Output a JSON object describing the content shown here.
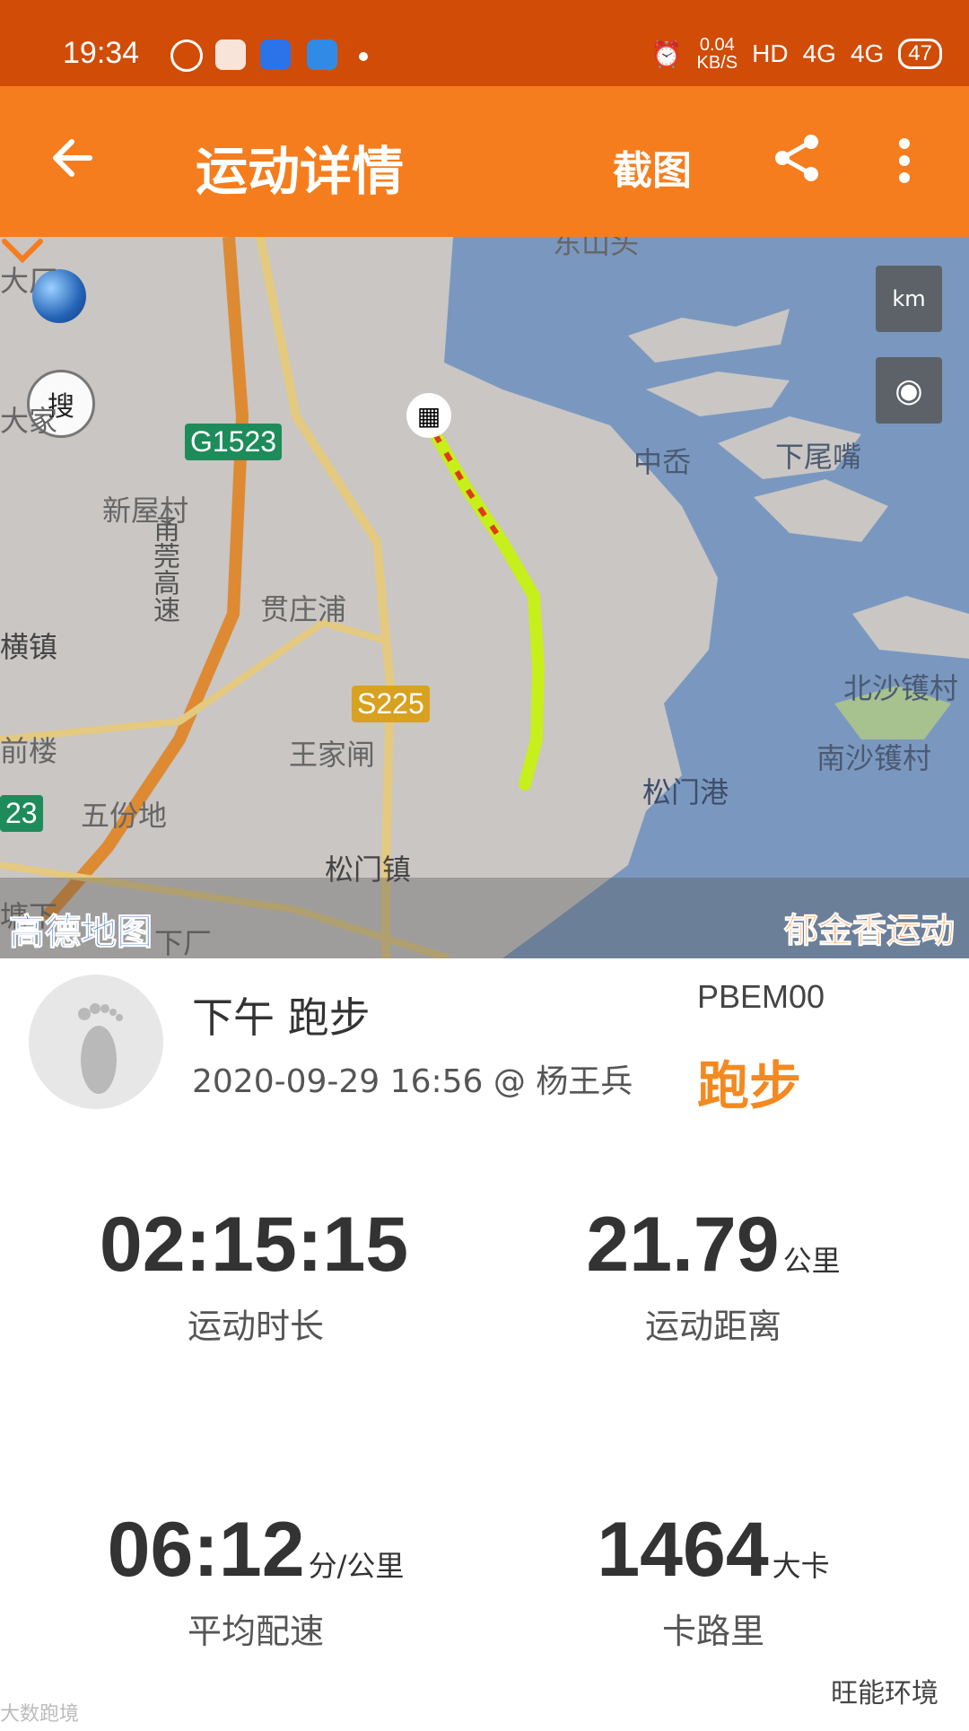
{
  "status_bar": {
    "time": "19:34",
    "net_speed_value": "0.04",
    "net_speed_unit": "KB/S",
    "hd": "HD",
    "signal1": "4G",
    "signal2": "4G",
    "battery": "47"
  },
  "app_bar": {
    "title": "运动详情",
    "screenshot_label": "截图"
  },
  "map": {
    "labels": [
      {
        "id": "a",
        "text": "大厂"
      },
      {
        "id": "b",
        "text": "大家"
      },
      {
        "id": "c",
        "text": "新屋村"
      },
      {
        "id": "d",
        "text": "贯庄浦"
      },
      {
        "id": "e",
        "text": "横镇"
      },
      {
        "id": "f",
        "text": "王家闸"
      },
      {
        "id": "g",
        "text": "五份地"
      },
      {
        "id": "h",
        "text": "松门镇"
      },
      {
        "id": "i",
        "text": "前楼"
      },
      {
        "id": "j",
        "text": "中岙"
      },
      {
        "id": "k",
        "text": "下尾嘴"
      },
      {
        "id": "l",
        "text": "北沙镬村"
      },
      {
        "id": "m",
        "text": "南沙镬村"
      },
      {
        "id": "n",
        "text": "松门港"
      },
      {
        "id": "o",
        "text": "下厂"
      },
      {
        "id": "p",
        "text": "塘下"
      },
      {
        "id": "q",
        "text": "东山头"
      }
    ],
    "road_g": "G1523",
    "road_g2": "23",
    "road_s": "S225",
    "expressway": "甬莞高速",
    "search_btn": "搜",
    "km_btn": "km",
    "provider": "高德地图",
    "brand": "郁金香运动"
  },
  "activity": {
    "title": "下午 跑步",
    "meta": "2020-09-29 16:56 @ 杨王兵",
    "device": "PBEM00",
    "type": "跑步"
  },
  "stats": {
    "duration": {
      "value": "02:15:15",
      "unit": "",
      "label": "运动时长"
    },
    "distance": {
      "value": "21.79",
      "unit": "公里",
      "label": "运动距离"
    },
    "pace": {
      "value": "06:12",
      "unit": "分/公里",
      "label": "平均配速"
    },
    "calories": {
      "value": "1464",
      "unit": "大卡",
      "label": "卡路里"
    }
  },
  "watermarks": {
    "left": "大数跑境",
    "right": "旺能环境"
  },
  "colors": {
    "status_bar": "#d14c06",
    "app_bar": "#f57d1d",
    "accent": "#f28a21",
    "sea": "#7a98bf",
    "land": "#c9c6c4",
    "track": "#c6ef1c"
  }
}
